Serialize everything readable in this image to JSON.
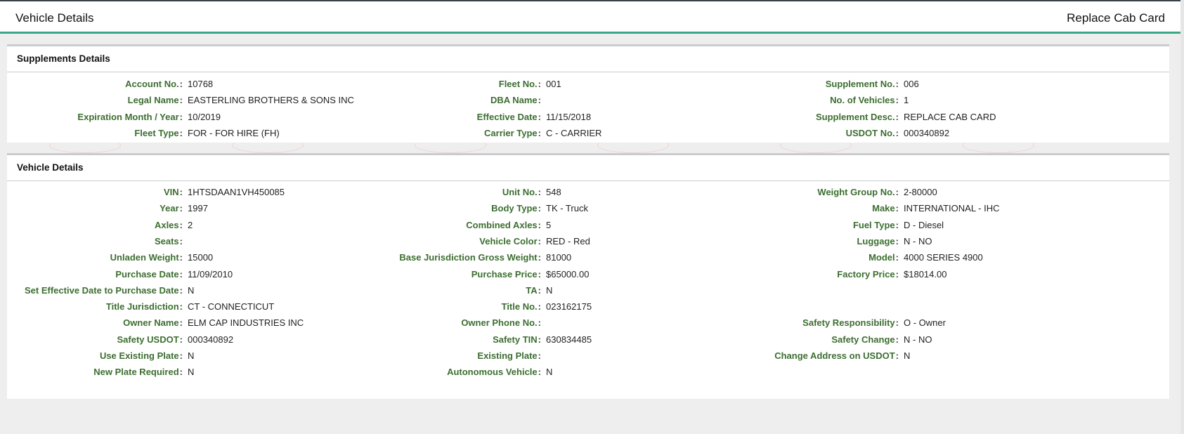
{
  "header": {
    "title": "Vehicle Details",
    "right_title": "Replace Cab Card"
  },
  "supplements": {
    "title": "Supplements Details",
    "rows": [
      [
        {
          "label": "Account No.",
          "value": "10768"
        },
        {
          "label": "Fleet No.",
          "value": "001"
        },
        {
          "label": "Supplement No.",
          "value": "006"
        }
      ],
      [
        {
          "label": "Legal Name",
          "value": "EASTERLING BROTHERS & SONS INC"
        },
        {
          "label": "DBA Name",
          "value": ""
        },
        {
          "label": "No. of Vehicles",
          "value": "1"
        }
      ],
      [
        {
          "label": "Expiration Month / Year",
          "value": "10/2019"
        },
        {
          "label": "Effective Date",
          "value": "11/15/2018"
        },
        {
          "label": "Supplement Desc.",
          "value": "REPLACE CAB CARD"
        }
      ],
      [
        {
          "label": "Fleet Type",
          "value": "FOR - FOR HIRE (FH)"
        },
        {
          "label": "Carrier Type",
          "value": "C - CARRIER"
        },
        {
          "label": "USDOT No.",
          "value": "000340892"
        }
      ]
    ]
  },
  "vehicle": {
    "title": "Vehicle Details",
    "rows": [
      [
        {
          "label": "VIN",
          "value": "1HTSDAAN1VH450085"
        },
        {
          "label": "Unit No.",
          "value": "548"
        },
        {
          "label": "Weight Group No.",
          "value": "2-80000"
        }
      ],
      [
        {
          "label": "Year",
          "value": "1997"
        },
        {
          "label": "Body Type",
          "value": "TK - Truck"
        },
        {
          "label": "Make",
          "value": "INTERNATIONAL - IHC"
        }
      ],
      [
        {
          "label": "Axles",
          "value": "2"
        },
        {
          "label": "Combined Axles",
          "value": "5"
        },
        {
          "label": "Fuel Type",
          "value": "D - Diesel"
        }
      ],
      [
        {
          "label": "Seats",
          "value": ""
        },
        {
          "label": "Vehicle Color",
          "value": "RED - Red"
        },
        {
          "label": "Luggage",
          "value": "N - NO"
        }
      ],
      [
        {
          "label": "Unladen Weight",
          "value": "15000"
        },
        {
          "label": "Base Jurisdiction Gross Weight",
          "value": "81000"
        },
        {
          "label": "Model",
          "value": "4000 SERIES 4900"
        }
      ],
      [
        {
          "label": "Purchase Date",
          "value": "11/09/2010"
        },
        {
          "label": "Purchase Price",
          "value": "$65000.00"
        },
        {
          "label": "Factory Price",
          "value": "$18014.00"
        }
      ],
      [
        {
          "label": "Set Effective Date to Purchase Date",
          "value": "N"
        },
        {
          "label": "TA",
          "value": "N"
        },
        null
      ],
      [
        {
          "label": "Title Jurisdiction",
          "value": "CT - CONNECTICUT"
        },
        {
          "label": "Title No.",
          "value": "023162175"
        },
        null
      ],
      [
        {
          "label": "Owner Name",
          "value": "ELM CAP INDUSTRIES INC"
        },
        {
          "label": "Owner Phone No.",
          "value": ""
        },
        {
          "label": "Safety Responsibility",
          "value": "O - Owner"
        }
      ],
      [
        {
          "label": "Safety USDOT",
          "value": "000340892"
        },
        {
          "label": "Safety TIN",
          "value": "630834485"
        },
        {
          "label": "Safety Change",
          "value": "N - NO"
        }
      ],
      [
        {
          "label": "Use Existing Plate",
          "value": "N"
        },
        {
          "label": "Existing Plate",
          "value": ""
        },
        {
          "label": "Change Address on USDOT",
          "value": "N"
        }
      ],
      [
        {
          "label": "New Plate Required",
          "value": "N"
        },
        {
          "label": "Autonomous Vehicle",
          "value": "N"
        },
        null
      ]
    ]
  },
  "colors": {
    "label": "#3c6e30",
    "accent": "#3aa886",
    "divider": "#c9cbcf"
  }
}
